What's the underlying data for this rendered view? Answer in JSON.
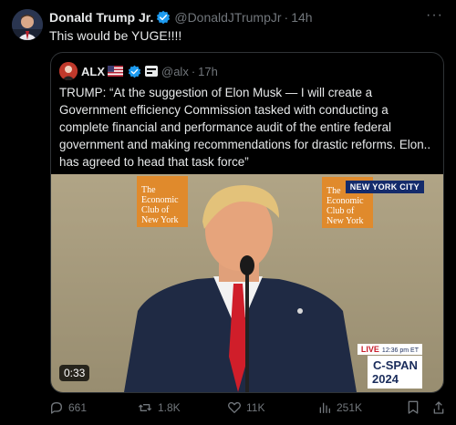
{
  "tweet": {
    "author_name": "Donald Trump Jr.",
    "handle": "@DonaldJTrumpJr",
    "time": "14h",
    "text": "This would be YUGE!!!!",
    "menu_icon": "more-icon"
  },
  "quoted": {
    "author_name": "ALX",
    "handle": "@alx",
    "time": "17h",
    "text": "TRUMP: “At the suggestion of Elon Musk — I will create a Government efficiency Commission tasked with conducting a complete financial and performance audit of the entire federal government and making recommendations for drastic reforms. Elon.. has agreed to head that task force”",
    "media": {
      "duration": "0:33",
      "banner_top": "NEW YORK CITY",
      "live_label": "LIVE",
      "live_time": "12:36 pm ET",
      "network": "C-SPAN",
      "network_year": "2024",
      "club_line1": "The",
      "club_line2": "Economic",
      "club_line3": "Club of",
      "club_line4": "New York"
    }
  },
  "actions": {
    "replies": "661",
    "reposts": "1.8K",
    "likes": "11K",
    "views": "251K"
  },
  "colors": {
    "background": "#000000",
    "text": "#e7e9ea",
    "muted": "#71767b",
    "border": "#2f3336",
    "verified": "#1d9bf0"
  }
}
